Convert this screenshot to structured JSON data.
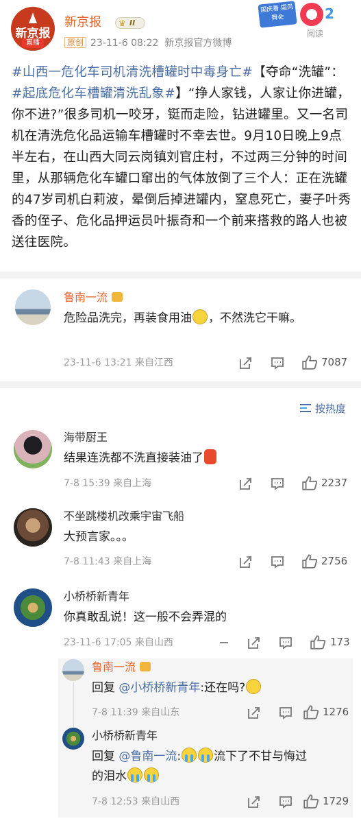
{
  "post": {
    "author": "新京报",
    "vip_level": "II",
    "original_tag": "原创",
    "timestamp": "23-11-6 08:22",
    "source": "新京报官方微博",
    "read_label": "阅读",
    "banner_text": "国庆看 国风舞会",
    "banner_number": "2",
    "avatar_logo": "新京报",
    "avatar_live": "直播",
    "body": {
      "tag1": "#山西一危化车司机清洗槽罐时中毒身亡#",
      "text1": "【夺命“洗罐”：",
      "tag2": "#起底危化车槽罐清洗乱象#",
      "text2": "】“挣人家钱，人家让你进罐，你不进?”很多司机一咬牙，铤而走险，钻进罐里。又一名司机在清洗危化品运输车槽罐时不幸去世。9月10日晚上9点半左右，在山西大同云岗镇刘官庄村，不过两三分钟的时间里，从那辆危化车罐口窜出的气体放倒了三个人：正在洗罐的47岁司机白莉波，晕倒后掉进罐内，窒息死亡，妻子叶秀香的侄子、危化品押运员叶振奇和一个前来搭救的路人也被送往医院。"
    }
  },
  "top_comment": {
    "user": "鲁南一流",
    "text": "危险品洗完，再装食用油",
    "text_after": "，不然洗它干嘛。",
    "time": "23-11-6 13:21",
    "location": "来自江西",
    "likes": "7087"
  },
  "sort_label": "按热度",
  "comments": [
    {
      "user": "海带厨王",
      "text": "结果连洗都不洗直接装油了",
      "time": "7-8 15:39",
      "location": "来自上海",
      "likes": "2237"
    },
    {
      "user": "不坐跳楼机改乘宇宙飞船",
      "text": "大预言家。。。",
      "time": "7-8 11:43",
      "location": "来自上海",
      "likes": "2756"
    },
    {
      "user": "小桥桥新青年",
      "text": "你真敢乱说！这一般不会弄混的",
      "time": "23-11-6 17:05",
      "location": "来自山西",
      "likes": "173"
    }
  ],
  "replies": [
    {
      "user": "鲁南一流",
      "prefix": "回复 ",
      "mention": "@小桥桥新青年",
      "text": ":还在吗?",
      "time": "7-8 11:39",
      "location": "来自山东",
      "likes": "1276"
    },
    {
      "user": "小桥桥新青年",
      "prefix": "回复 ",
      "mention": "@鲁南一流",
      "text": ":",
      "text_after": "流下了不甘与悔过",
      "text_line2": "的泪水",
      "time": "7-8 12:53",
      "location": "来自山西",
      "likes": "1729"
    }
  ],
  "colors": {
    "accent_orange": "#e8652a",
    "link_blue": "#4a6ea3",
    "divider": "#f2f2f2"
  },
  "icons": [
    "crown-icon",
    "block-icon",
    "share-icon",
    "comment-icon",
    "like-icon",
    "sort-icon"
  ]
}
